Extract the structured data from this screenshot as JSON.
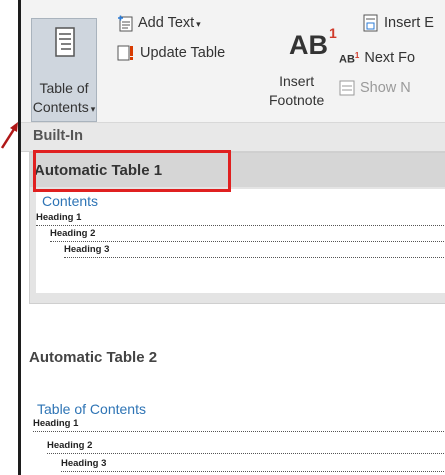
{
  "ribbon": {
    "toc_label_1": "Table of",
    "toc_label_2": "Contents",
    "add_text": "Add Text",
    "update_table": "Update Table",
    "insert_footnote_1": "Insert",
    "insert_footnote_2": "Footnote",
    "insert_endnote": "Insert E",
    "next_footnote": "Next Fo",
    "show_notes": "Show N"
  },
  "gallery": {
    "section_header": "Built-In",
    "items": [
      {
        "title": "Automatic Table 1",
        "heading": "Contents",
        "lines": [
          "Heading 1",
          "Heading 2",
          "Heading 3"
        ]
      },
      {
        "title": "Automatic Table 2",
        "heading": "Table of Contents",
        "lines": [
          "Heading 1",
          "Heading 2",
          "Heading 3"
        ]
      }
    ]
  },
  "colors": {
    "highlight": "#e02020",
    "toc_heading": "#2e74b5"
  }
}
